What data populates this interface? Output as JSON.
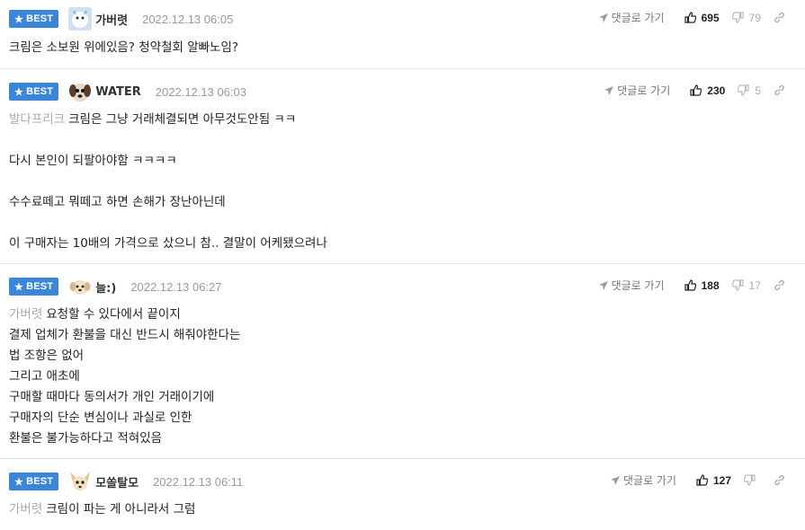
{
  "labels": {
    "best": "BEST",
    "reply_link": "댓글로 가기"
  },
  "colors": {
    "best_badge": "#3c86d8",
    "date_text": "#999999",
    "mention_text": "#aaaaaa"
  },
  "comments": [
    {
      "avatar_icon": "snow-character-avatar",
      "nickname": "가버렷",
      "date": "2022.12.13 06:05",
      "likes": "695",
      "dislikes": "79",
      "mention": "",
      "lines": [
        "크림은 소보원 위에있음? 청약철회 알빠노임?"
      ]
    },
    {
      "avatar_icon": "dog-face-avatar",
      "nickname": "WATER",
      "date": "2022.12.13 06:03",
      "likes": "230",
      "dislikes": "5",
      "mention": "발다프리크",
      "lines": [
        "크림은 그냥 거래체결되면 아무것도안됨 ㅋㅋ",
        "",
        "다시 본인이 되팔아야함 ㅋㅋㅋㅋ",
        "",
        "수수료떼고 뭐떼고 하면 손해가 장난아닌데",
        "",
        "이 구매자는 10배의 가격으로 샀으니 참.. 결말이 어케됐으려나"
      ]
    },
    {
      "avatar_icon": "puppy-avatar",
      "nickname": "늘:)",
      "date": "2022.12.13 06:27",
      "likes": "188",
      "dislikes": "17",
      "mention": "가버렷",
      "lines": [
        "요청할 수 있다에서 끝이지",
        "결제 업체가 환불을 대신 반드시 해줘야한다는",
        "법 조항은 없어",
        "그리고 애초에",
        "구매할 때마다 동의서가 개인 거래이기에",
        "구매자의 단순 변심이나 과실로 인한",
        "환불은 불가능하다고 적혀있음"
      ]
    },
    {
      "avatar_icon": "chihuahua-avatar",
      "nickname": "모쏠탈모",
      "date": "2022.12.13 06:11",
      "likes": "127",
      "dislikes": "",
      "mention": "가버렷",
      "lines": [
        "크림이 파는 게 아니라서 그럼"
      ]
    }
  ]
}
